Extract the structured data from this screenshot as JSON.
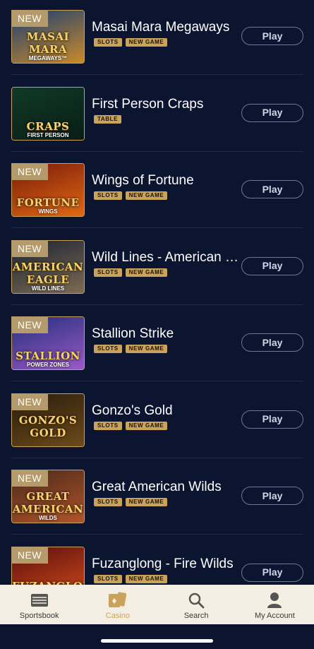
{
  "games": [
    {
      "title": "Masai Mara Megaways",
      "is_new": true,
      "new_label": "NEW",
      "tags": [
        "SLOTS",
        "NEW GAME"
      ],
      "play_label": "Play",
      "art_text": "MASAI MARA",
      "art_sub": "MEGAWAYS™"
    },
    {
      "title": "First Person Craps",
      "is_new": false,
      "new_label": "",
      "tags": [
        "TABLE"
      ],
      "play_label": "Play",
      "art_text": "CRAPS",
      "art_sub": "FIRST PERSON"
    },
    {
      "title": "Wings of Fortune",
      "is_new": true,
      "new_label": "NEW",
      "tags": [
        "SLOTS",
        "NEW GAME"
      ],
      "play_label": "Play",
      "art_text": "FORTUNE",
      "art_sub": "WINGS"
    },
    {
      "title": "Wild Lines - American Eagle",
      "is_new": true,
      "new_label": "NEW",
      "tags": [
        "SLOTS",
        "NEW GAME"
      ],
      "play_label": "Play",
      "art_text": "AMERICAN EAGLE",
      "art_sub": "WILD LINES"
    },
    {
      "title": "Stallion Strike",
      "is_new": true,
      "new_label": "NEW",
      "tags": [
        "SLOTS",
        "NEW GAME"
      ],
      "play_label": "Play",
      "art_text": "STALLION",
      "art_sub": "POWER ZONES"
    },
    {
      "title": "Gonzo's Gold",
      "is_new": true,
      "new_label": "NEW",
      "tags": [
        "SLOTS",
        "NEW GAME"
      ],
      "play_label": "Play",
      "art_text": "GONZO'S GOLD",
      "art_sub": ""
    },
    {
      "title": "Great American Wilds",
      "is_new": true,
      "new_label": "NEW",
      "tags": [
        "SLOTS",
        "NEW GAME"
      ],
      "play_label": "Play",
      "art_text": "GREAT AMERICAN",
      "art_sub": "WILDS"
    },
    {
      "title": "Fuzanglong - Fire Wilds",
      "is_new": true,
      "new_label": "NEW",
      "tags": [
        "SLOTS",
        "NEW GAME"
      ],
      "play_label": "Play",
      "art_text": "FUZANGLONG",
      "art_sub": ""
    }
  ],
  "thumb_colors": [
    [
      "#1c3f73",
      "#c98a2a"
    ],
    [
      "#0f3a28",
      "#0a1d14"
    ],
    [
      "#7a1a0a",
      "#e06a12"
    ],
    [
      "#1a2433",
      "#7e6a52"
    ],
    [
      "#23307a",
      "#9b59c9"
    ],
    [
      "#2a1c0c",
      "#6b4b1a"
    ],
    [
      "#4a2a1a",
      "#b0542a"
    ],
    [
      "#5a0f0f",
      "#d04a1a"
    ]
  ],
  "tabbar": {
    "items": [
      {
        "label": "Sportsbook",
        "icon": "sportsbook-icon",
        "active": false
      },
      {
        "label": "Casino",
        "icon": "casino-icon",
        "active": true
      },
      {
        "label": "Search",
        "icon": "search-icon",
        "active": false
      },
      {
        "label": "My Account",
        "icon": "account-icon",
        "active": false
      }
    ]
  },
  "colors": {
    "accent": "#c9a35c",
    "background": "#0b1530",
    "tabbar": "#f4efe2"
  }
}
